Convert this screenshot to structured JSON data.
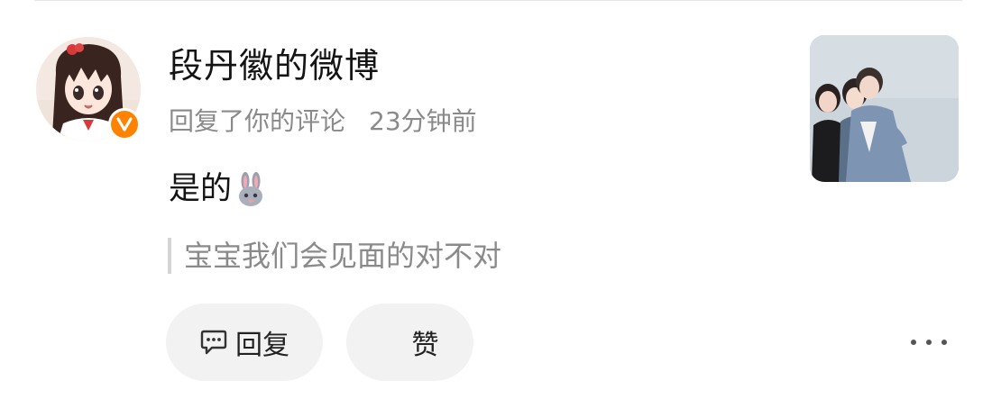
{
  "comment": {
    "username": "段丹徽的微博",
    "action": "回复了你的评论",
    "time": "23分钟前",
    "reply": "是的",
    "reply_emoji": "rabbit-emoji",
    "quoted": "宝宝我们会见面的对不对"
  },
  "avatar": {
    "icon": "anime-girl-avatar",
    "badge": "verified-badge-icon",
    "badge_color": "#ff8200"
  },
  "thumbnail": {
    "icon": "photo-thumbnail"
  },
  "actions": {
    "reply_label": "回复",
    "reply_icon": "comment-icon",
    "like_label": "赞",
    "more_icon": "more-dots-icon"
  },
  "colors": {
    "text_primary": "#141414",
    "text_secondary": "#8a8a8a",
    "pill_bg": "#f2f2f2",
    "accent": "#ff8200"
  }
}
